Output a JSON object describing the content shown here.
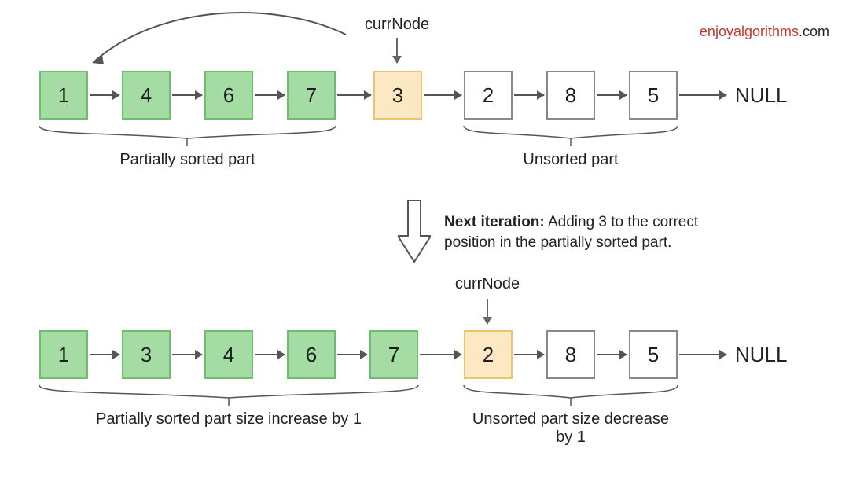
{
  "brand": {
    "accent": "enjoyalgorithms",
    "rest": ".com"
  },
  "currNodeLabel": "currNode",
  "nullLabel": "NULL",
  "transition": {
    "heading": "Next iteration:",
    "body": " Adding 3 to the correct position in the partially sorted part."
  },
  "chart_data": {
    "type": "diagram",
    "description": "Insertion sort on a singly linked list — one iteration",
    "states": [
      {
        "sorted": [
          1,
          4,
          6,
          7
        ],
        "currNode": 3,
        "unsorted": [
          2,
          8,
          5
        ],
        "sortedCaption": "Partially sorted part",
        "unsortedCaption": "Unsorted part"
      },
      {
        "sorted": [
          1,
          3,
          4,
          6,
          7
        ],
        "currNode": 2,
        "unsorted": [
          8,
          5
        ],
        "sortedCaption": "Partially sorted part size increase by 1",
        "unsortedCaption": "Unsorted part size decrease by 1"
      }
    ]
  }
}
